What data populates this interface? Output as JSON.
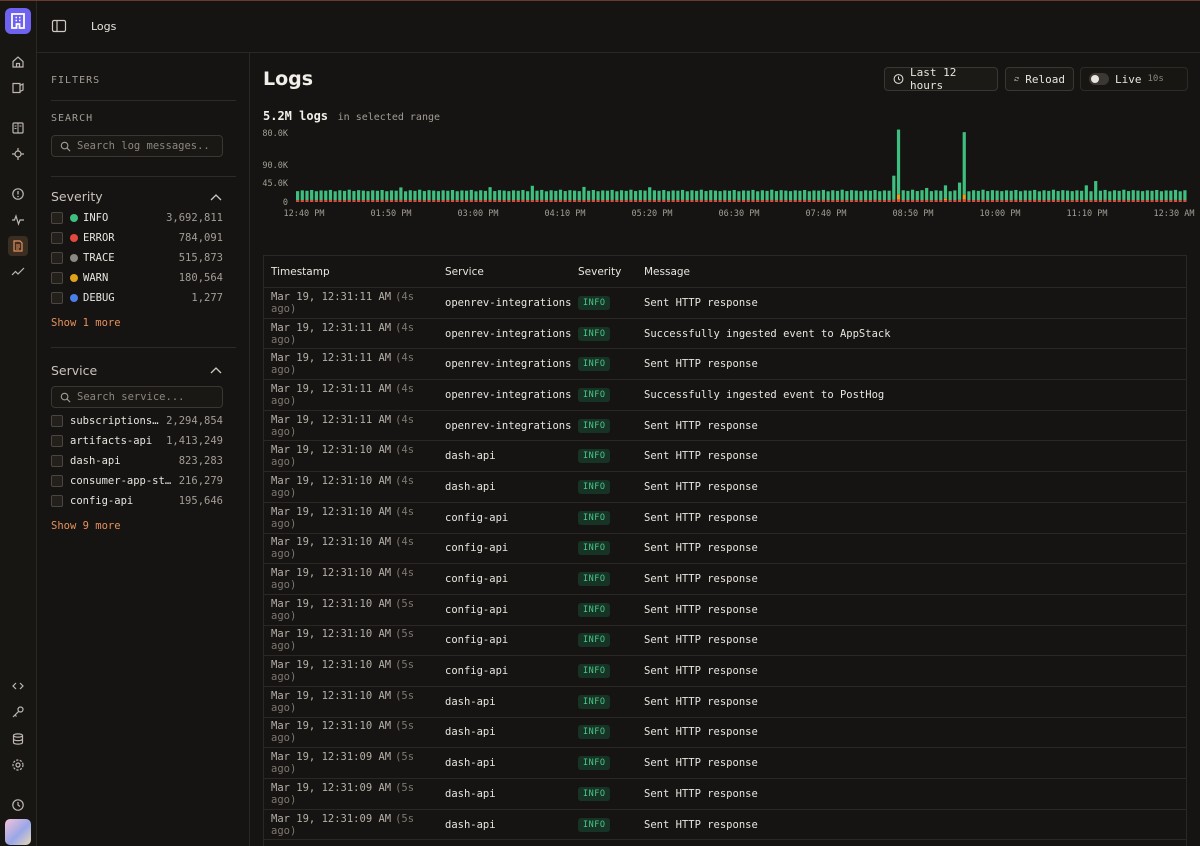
{
  "nav": {
    "breadcrumb": "Logs"
  },
  "filters": {
    "heading": "FILTERS",
    "search_label": "SEARCH",
    "search_placeholder": "Search log messages..",
    "severity": {
      "title": "Severity",
      "items": [
        {
          "label": "INFO",
          "count": "3,692,811",
          "color": "#3fbf7f"
        },
        {
          "label": "ERROR",
          "count": "784,091",
          "color": "#e5483c"
        },
        {
          "label": "TRACE",
          "count": "515,873",
          "color": "#8c8884"
        },
        {
          "label": "WARN",
          "count": "180,564",
          "color": "#e0a11b"
        },
        {
          "label": "DEBUG",
          "count": "1,277",
          "color": "#4a7ee8"
        }
      ],
      "more": "Show 1 more"
    },
    "service": {
      "title": "Service",
      "search_placeholder": "Search service...",
      "items": [
        {
          "label": "subscriptions-…",
          "count": "2,294,854"
        },
        {
          "label": "artifacts-api",
          "count": "1,413,249"
        },
        {
          "label": "dash-api",
          "count": "823,283"
        },
        {
          "label": "consumer-app-sto…",
          "count": "216,279"
        },
        {
          "label": "config-api",
          "count": "195,646"
        }
      ],
      "more": "Show 9 more"
    }
  },
  "main": {
    "title": "Logs",
    "time_range_button": "Last 12 hours",
    "reload_button": "Reload",
    "live_label": "Live",
    "live_interval": "10s",
    "summary_count": "5.2M logs",
    "summary_suffix": "in selected range"
  },
  "chart_data": {
    "type": "bar",
    "stacked": true,
    "y_tick_labels": [
      "80.0K",
      "90.0K",
      "45.0K",
      "0"
    ],
    "x_tick_labels": [
      "12:40 PM",
      "01:50 PM",
      "03:00 PM",
      "04:10 PM",
      "05:20 PM",
      "06:30 PM",
      "07:40 PM",
      "08:50 PM",
      "10:00 PM",
      "11:10 PM",
      "12:30 AM"
    ],
    "ylim": [
      0,
      80000
    ],
    "series": [
      {
        "name": "INFO",
        "color": "#3fbf7f",
        "values": [
          10500,
          11200,
          10800,
          11500,
          10400,
          11100,
          10900,
          11600,
          10300,
          11300,
          10700,
          11800,
          10600,
          11400,
          11000,
          10500,
          11200,
          10800,
          11500,
          10400,
          11100,
          10900,
          14500,
          10300,
          11300,
          10700,
          11800,
          10600,
          11400,
          11000,
          10500,
          11200,
          10800,
          11500,
          10400,
          11100,
          10900,
          11600,
          10300,
          11300,
          10700,
          14800,
          10600,
          11400,
          11000,
          10500,
          11200,
          10800,
          11500,
          10400,
          16500,
          10900,
          11600,
          10300,
          11300,
          10700,
          11800,
          10600,
          11400,
          11000,
          10500,
          15200,
          10800,
          11500,
          10400,
          11100,
          10900,
          11600,
          10300,
          11300,
          10700,
          11800,
          10600,
          11400,
          11000,
          15000,
          11200,
          10800,
          11500,
          10400,
          11100,
          10900,
          11600,
          10300,
          11300,
          10700,
          11800,
          10600,
          11400,
          11000,
          10500,
          11200,
          10800,
          11500,
          10400,
          11100,
          10900,
          11600,
          10300,
          11300,
          10700,
          11800,
          10600,
          11400,
          11000,
          10500,
          11200,
          10800,
          11500,
          10400,
          11100,
          10900,
          11600,
          10300,
          11300,
          10700,
          11800,
          10600,
          11400,
          11000,
          10500,
          11200,
          10800,
          11500,
          10400,
          11100,
          10900,
          11600,
          10300,
          11300,
          10700,
          11800,
          10600,
          11400,
          11000,
          10500,
          11200,
          10800,
          11500,
          10400,
          11100,
          10900,
          11600,
          10300,
          11300,
          10700,
          11800,
          10600,
          11400,
          11000,
          10500,
          11200,
          10800,
          11500,
          10400,
          11100,
          10900,
          11600,
          10300,
          11300,
          10700,
          11800,
          10600,
          11400,
          11000,
          10500,
          11200,
          10800,
          11500,
          10400,
          11100,
          10900,
          11600,
          10300,
          11300,
          10700,
          11800,
          10600,
          11400,
          11000,
          10500,
          11200,
          10800,
          11500,
          10400,
          11100,
          10900,
          11600,
          10300,
          11300
        ]
      },
      {
        "name": "ERROR",
        "color": "#e5483c",
        "values": [
          2100,
          2300,
          2200,
          2400,
          2100,
          2300,
          2200,
          2400,
          2100,
          2300,
          2200,
          2400,
          2100,
          2300,
          2200,
          2100,
          2300,
          2200,
          2400,
          2100,
          2300,
          2200,
          2400,
          2100,
          2300,
          2200,
          2400,
          2100,
          2300,
          2200,
          2100,
          2300,
          2200,
          2400,
          2100,
          2300,
          2200,
          2400,
          2100,
          2300,
          2200,
          2400,
          2100,
          2300,
          2200,
          2100,
          2300,
          2200,
          2400,
          2100,
          2300,
          2200,
          2400,
          2100,
          2300,
          2200,
          2400,
          2100,
          2300,
          2200,
          2100,
          2300,
          2200,
          2400,
          2100,
          2300,
          2200,
          2400,
          2100,
          2300,
          2200,
          2400,
          2100,
          2300,
          2200,
          2100,
          2300,
          2200,
          2400,
          2100,
          2300,
          2200,
          2400,
          2100,
          2300,
          2200,
          2400,
          2100,
          2300,
          2200,
          2100,
          2300,
          2200,
          2400,
          2100,
          2300,
          2200,
          2400,
          2100,
          2300,
          2200,
          2400,
          2100,
          2300,
          2200,
          2100,
          2300,
          2200,
          2400,
          2100,
          2300,
          2200,
          2400,
          2100,
          2300,
          2200,
          2400,
          2100,
          2300,
          2200,
          2100,
          2300,
          2200,
          2400,
          2100,
          2300,
          2200,
          2400,
          2100,
          2300,
          2200,
          2400,
          2100,
          2300,
          2200,
          2100,
          2300,
          2200,
          2400,
          2100,
          2300,
          2200,
          2400,
          2100,
          2300,
          2200,
          2400,
          2100,
          2300,
          2200,
          2100,
          2300,
          2200,
          2400,
          2100,
          2300,
          2200,
          2400,
          2100,
          2300,
          2200,
          2400,
          2100,
          2300,
          2200,
          2100,
          2300,
          2200,
          2400,
          2100,
          2300,
          2200,
          2400,
          2100,
          2300,
          2200,
          2400,
          2100,
          2300,
          2200,
          2100,
          2300,
          2200,
          2400,
          2100,
          2300,
          2200,
          2400,
          2100,
          2300
        ]
      },
      {
        "name": "WARN",
        "color": "#e0a11b",
        "values": [
          0,
          0,
          0,
          0,
          0,
          0,
          0,
          0,
          0,
          0,
          0,
          0,
          0,
          0,
          0,
          0,
          0,
          0,
          0,
          0,
          0,
          0,
          0,
          0,
          0,
          0,
          0,
          0,
          0,
          0,
          0,
          0,
          0,
          0,
          0,
          0,
          0,
          0,
          0,
          0,
          0,
          0,
          0,
          0,
          0,
          0,
          0,
          0,
          0,
          0,
          0,
          0,
          0,
          0,
          0,
          0,
          0,
          0,
          0,
          0,
          0,
          0,
          0,
          0,
          0,
          0,
          0,
          0,
          0,
          0,
          0,
          0,
          0,
          0,
          0,
          0,
          0,
          0,
          0,
          0,
          0,
          0,
          0,
          0,
          0,
          0,
          0,
          0,
          0,
          0,
          0,
          0,
          0,
          0,
          0,
          0,
          0,
          0,
          0,
          0,
          0,
          0,
          0,
          0,
          0,
          0,
          0,
          0,
          0,
          0,
          0,
          0,
          0,
          0,
          0,
          0,
          0,
          0,
          0,
          0,
          0,
          0,
          0,
          0,
          0,
          0,
          0,
          0,
          0,
          0,
          0,
          0,
          0,
          0,
          0,
          0,
          0,
          0,
          0,
          0,
          0,
          0,
          0,
          0,
          0,
          0,
          0,
          0,
          0,
          0,
          0,
          0,
          0,
          0,
          0,
          0,
          0,
          0,
          0,
          0,
          0,
          0,
          0,
          0,
          0,
          0,
          0,
          0,
          0,
          0,
          0,
          0,
          0,
          0,
          0,
          0,
          0,
          0,
          0,
          0,
          0,
          0,
          0,
          0,
          0,
          0,
          0,
          0,
          0,
          0,
          0,
          0,
          0,
          0
        ]
      }
    ],
    "spikes": [
      {
        "index": 128,
        "INFO": 75000,
        "WARN": 6000,
        "ERROR": 3000
      },
      {
        "index": 127,
        "INFO": 28000,
        "WARN": 0,
        "ERROR": 2500
      },
      {
        "index": 142,
        "INFO": 72000,
        "WARN": 6000,
        "ERROR": 3000
      },
      {
        "index": 141,
        "INFO": 20000,
        "WARN": 0,
        "ERROR": 2500
      },
      {
        "index": 138,
        "INFO": 15000,
        "WARN": 2000,
        "ERROR": 2300
      },
      {
        "index": 134,
        "INFO": 14000,
        "WARN": 0,
        "ERROR": 2300
      },
      {
        "index": 170,
        "INFO": 22000,
        "WARN": 0,
        "ERROR": 2300
      },
      {
        "index": 168,
        "INFO": 17000,
        "WARN": 0,
        "ERROR": 2300
      }
    ]
  },
  "table": {
    "headers": [
      "Timestamp",
      "Service",
      "Severity",
      "Message"
    ],
    "rows": [
      {
        "time": "Mar 19, 12:31:11 AM",
        "ago": "(4s ago)",
        "service": "openrev-integrations",
        "severity": "INFO",
        "message": "Sent HTTP response"
      },
      {
        "time": "Mar 19, 12:31:11 AM",
        "ago": "(4s ago)",
        "service": "openrev-integrations",
        "severity": "INFO",
        "message": "Successfully ingested event to AppStack"
      },
      {
        "time": "Mar 19, 12:31:11 AM",
        "ago": "(4s ago)",
        "service": "openrev-integrations",
        "severity": "INFO",
        "message": "Sent HTTP response"
      },
      {
        "time": "Mar 19, 12:31:11 AM",
        "ago": "(4s ago)",
        "service": "openrev-integrations",
        "severity": "INFO",
        "message": "Successfully ingested event to PostHog"
      },
      {
        "time": "Mar 19, 12:31:11 AM",
        "ago": "(4s ago)",
        "service": "openrev-integrations",
        "severity": "INFO",
        "message": "Sent HTTP response"
      },
      {
        "time": "Mar 19, 12:31:10 AM",
        "ago": "(4s ago)",
        "service": "dash-api",
        "severity": "INFO",
        "message": "Sent HTTP response"
      },
      {
        "time": "Mar 19, 12:31:10 AM",
        "ago": "(4s ago)",
        "service": "dash-api",
        "severity": "INFO",
        "message": "Sent HTTP response"
      },
      {
        "time": "Mar 19, 12:31:10 AM",
        "ago": "(4s ago)",
        "service": "config-api",
        "severity": "INFO",
        "message": "Sent HTTP response"
      },
      {
        "time": "Mar 19, 12:31:10 AM",
        "ago": "(4s ago)",
        "service": "config-api",
        "severity": "INFO",
        "message": "Sent HTTP response"
      },
      {
        "time": "Mar 19, 12:31:10 AM",
        "ago": "(4s ago)",
        "service": "config-api",
        "severity": "INFO",
        "message": "Sent HTTP response"
      },
      {
        "time": "Mar 19, 12:31:10 AM",
        "ago": "(5s ago)",
        "service": "config-api",
        "severity": "INFO",
        "message": "Sent HTTP response"
      },
      {
        "time": "Mar 19, 12:31:10 AM",
        "ago": "(5s ago)",
        "service": "config-api",
        "severity": "INFO",
        "message": "Sent HTTP response"
      },
      {
        "time": "Mar 19, 12:31:10 AM",
        "ago": "(5s ago)",
        "service": "config-api",
        "severity": "INFO",
        "message": "Sent HTTP response"
      },
      {
        "time": "Mar 19, 12:31:10 AM",
        "ago": "(5s ago)",
        "service": "dash-api",
        "severity": "INFO",
        "message": "Sent HTTP response"
      },
      {
        "time": "Mar 19, 12:31:10 AM",
        "ago": "(5s ago)",
        "service": "dash-api",
        "severity": "INFO",
        "message": "Sent HTTP response"
      },
      {
        "time": "Mar 19, 12:31:09 AM",
        "ago": "(5s ago)",
        "service": "dash-api",
        "severity": "INFO",
        "message": "Sent HTTP response"
      },
      {
        "time": "Mar 19, 12:31:09 AM",
        "ago": "(5s ago)",
        "service": "dash-api",
        "severity": "INFO",
        "message": "Sent HTTP response"
      },
      {
        "time": "Mar 19, 12:31:09 AM",
        "ago": "(5s ago)",
        "service": "dash-api",
        "severity": "INFO",
        "message": "Sent HTTP response"
      }
    ]
  }
}
